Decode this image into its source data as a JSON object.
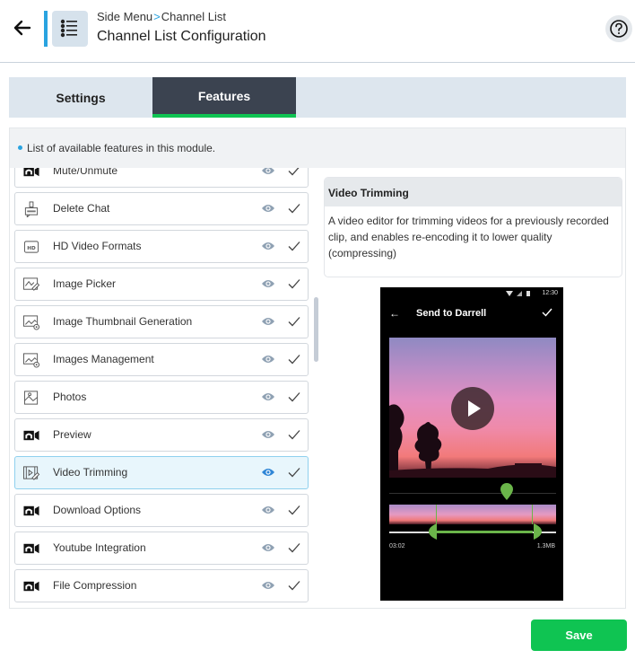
{
  "header": {
    "back_icon": "arrow-left-icon",
    "module_icon": "list-icon",
    "breadcrumb": {
      "parent": "Side Menu",
      "separator": ">",
      "current": "Channel List"
    },
    "title": "Channel List Configuration",
    "help_icon": "question-circle-icon"
  },
  "tabs": [
    {
      "label": "Settings",
      "active": false
    },
    {
      "label": "Features",
      "active": true
    }
  ],
  "colors": {
    "accent": "#29a3e0",
    "active_tab_bg": "#3b4350",
    "active_tab_underline": "#0fc452",
    "save": "#0fc452",
    "eye_active": "#2f86d6",
    "eye_inactive": "#8fa1b3"
  },
  "info_text": "List of available features in this module.",
  "features": [
    {
      "label": "Mute/Unmute",
      "icon": "camera-video-icon",
      "active": false
    },
    {
      "label": "Delete Chat",
      "icon": "delete-chat-icon",
      "active": false
    },
    {
      "label": "HD Video Formats",
      "icon": "hd-icon",
      "active": false
    },
    {
      "label": "Image Picker",
      "icon": "image-edit-icon",
      "active": false
    },
    {
      "label": "Image Thumbnail Generation",
      "icon": "image-settings-icon",
      "active": false
    },
    {
      "label": "Images Management",
      "icon": "image-settings-icon",
      "active": false
    },
    {
      "label": "Photos",
      "icon": "photo-icon",
      "active": false
    },
    {
      "label": "Preview",
      "icon": "camera-video-icon",
      "active": false
    },
    {
      "label": "Video Trimming",
      "icon": "video-edit-icon",
      "active": true
    },
    {
      "label": "Download Options",
      "icon": "camera-video-icon",
      "active": false
    },
    {
      "label": "Youtube Integration",
      "icon": "camera-video-icon",
      "active": false
    },
    {
      "label": "File Compression",
      "icon": "camera-video-icon",
      "active": false
    }
  ],
  "detail": {
    "title": "Video Trimming",
    "description": "A video editor for trimming videos for a previously recorded clip, and enables re-encoding it to lower quality (compressing)"
  },
  "preview": {
    "status_time": "12:30",
    "screen_title": "Send to Darrell",
    "elapsed": "03:02",
    "file_size": "1.3MB"
  },
  "save_label": "Save"
}
